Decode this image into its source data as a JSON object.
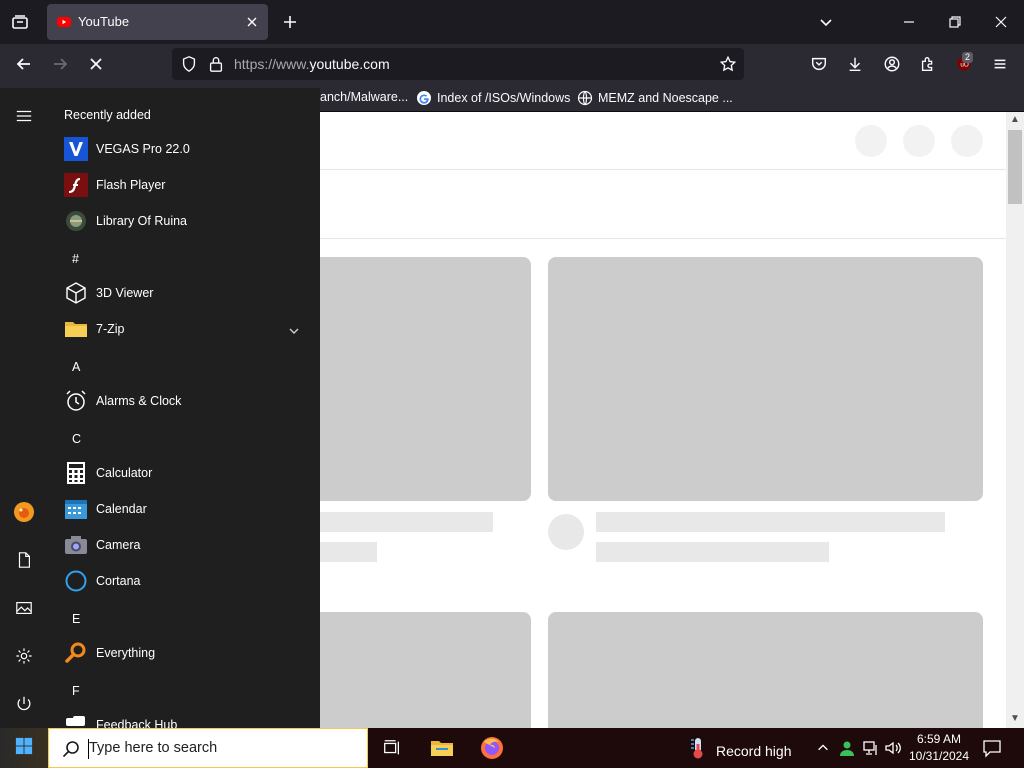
{
  "browser": {
    "tab": {
      "title": "YouTube"
    },
    "url": {
      "prefix": "https://www.",
      "domain": "youtube.com"
    },
    "extensions_badge": "2",
    "bookmarks": [
      "anch/Malware...",
      "Index of /ISOs/Windows",
      "MEMZ and Noescape ..."
    ]
  },
  "start_menu": {
    "section_title": "Recently added",
    "recent": [
      {
        "label": "VEGAS Pro 22.0",
        "icon": "vegas-icon"
      },
      {
        "label": "Flash Player",
        "icon": "flash-icon"
      },
      {
        "label": "Library Of Ruina",
        "icon": "ruina-icon"
      }
    ],
    "letters": [
      "#",
      "A",
      "C",
      "E",
      "F"
    ],
    "apps": {
      "hash": [
        {
          "label": "3D Viewer"
        },
        {
          "label": "7-Zip"
        }
      ],
      "a": [
        {
          "label": "Alarms & Clock"
        }
      ],
      "c": [
        {
          "label": "Calculator"
        },
        {
          "label": "Calendar"
        },
        {
          "label": "Camera"
        },
        {
          "label": "Cortana"
        }
      ],
      "e": [
        {
          "label": "Everything"
        }
      ],
      "f": [
        {
          "label": "Feedback Hub"
        }
      ]
    }
  },
  "taskbar": {
    "search_placeholder": "Type here to search",
    "weather": "Record high",
    "time": "6:59 AM",
    "date": "10/31/2024"
  },
  "colors": {
    "chrome_dark": "#1c1b22",
    "toolbar": "#2b2a33",
    "start_bg": "#1f1f1f",
    "skeleton": "#cccccc",
    "search_border": "#f2c94c"
  }
}
